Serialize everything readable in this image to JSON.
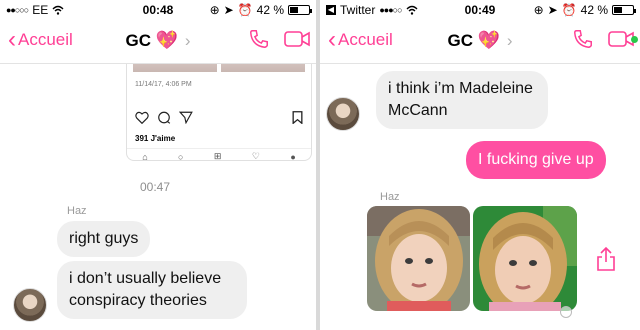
{
  "left": {
    "status": {
      "carrier": "EE",
      "time": "00:48",
      "battery": "42 %",
      "battery_level": 0.42
    },
    "nav": {
      "back_label": "Accueil",
      "title": "GC",
      "heart": "💖"
    },
    "post": {
      "date": "11/14/17, 4:06 PM",
      "likes": "391 J'aime"
    },
    "timestamp": "00:47",
    "sender": "Haz",
    "messages": [
      "right guys",
      "i don’t usually believe conspiracy theories"
    ]
  },
  "right": {
    "status": {
      "carrier": "Twitter",
      "time": "00:49",
      "battery": "42 %",
      "battery_level": 0.42
    },
    "nav": {
      "back_label": "Accueil",
      "title": "GC",
      "heart": "💖"
    },
    "incoming": "i think i’m Madeleine McCann",
    "outgoing": "I fucking give up",
    "sender": "Haz"
  },
  "colors": {
    "accent": "#ff4fa2",
    "bubble": "#efefef",
    "online": "#29c94a"
  },
  "icons": [
    "chevron-left-icon",
    "phone-icon",
    "video-icon",
    "heart-icon",
    "comment-icon",
    "send-icon",
    "bookmark-icon",
    "share-icon",
    "wifi-icon",
    "location-icon",
    "alarm-icon",
    "lock-rotation-icon"
  ]
}
